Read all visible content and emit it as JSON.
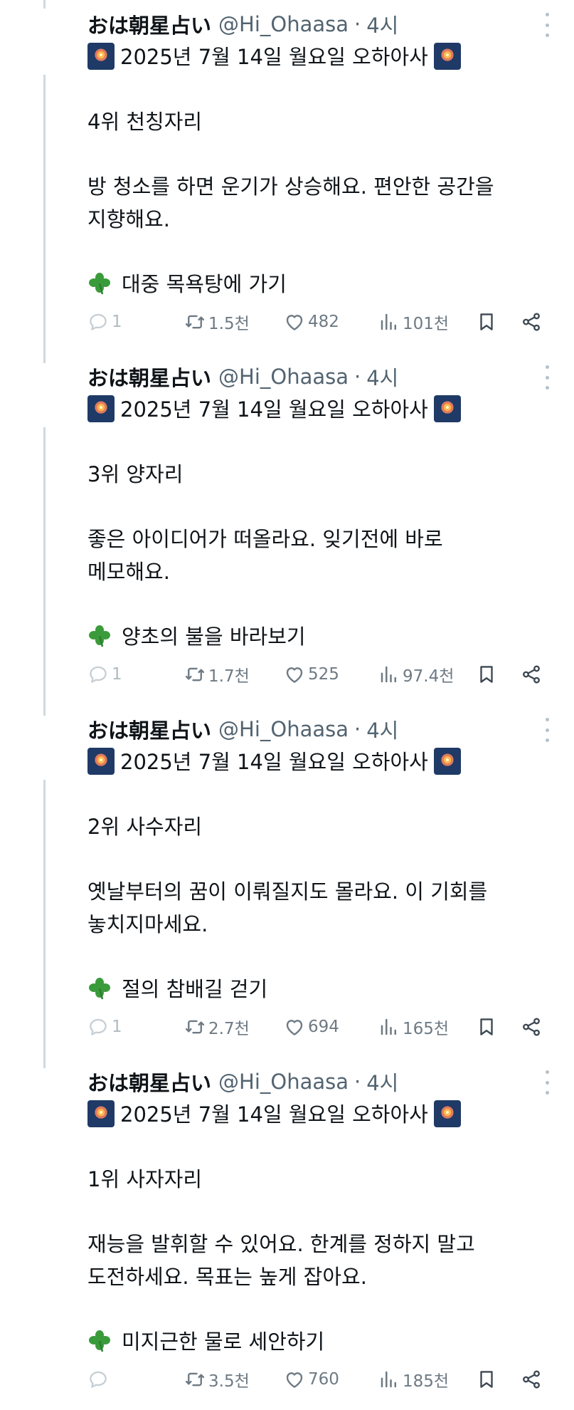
{
  "tweets": [
    {
      "author": "おは朝星占い",
      "handle": "@Hi_Ohaasa",
      "separator": "·",
      "time": "4시",
      "date_line": "2025년 7월 14일 월요일 오하아사",
      "rank": "4위 천칭자리",
      "message_line1": "방 청소를 하면 운기가 상승해요. 편안한 공간을",
      "message_line2": "지향해요.",
      "lucky": "대중 목욕탕에 가기",
      "replies": "1",
      "retweets": "1.5천",
      "likes": "482",
      "views": "101천"
    },
    {
      "author": "おは朝星占い",
      "handle": "@Hi_Ohaasa",
      "separator": "·",
      "time": "4시",
      "date_line": "2025년 7월 14일 월요일 오하아사",
      "rank": "3위 양자리",
      "message_line1": "좋은 아이디어가 떠올라요. 잊기전에 바로",
      "message_line2": "메모해요.",
      "lucky": "양초의 불을 바라보기",
      "replies": "1",
      "retweets": "1.7천",
      "likes": "525",
      "views": "97.4천"
    },
    {
      "author": "おは朝星占い",
      "handle": "@Hi_Ohaasa",
      "separator": "·",
      "time": "4시",
      "date_line": "2025년 7월 14일 월요일 오하아사",
      "rank": "2위 사수자리",
      "message_line1": "옛날부터의 꿈이 이뤄질지도 몰라요. 이 기회를",
      "message_line2": "놓치지마세요.",
      "lucky": "절의 참배길 걷기",
      "replies": "1",
      "retweets": "2.7천",
      "likes": "694",
      "views": "165천"
    },
    {
      "author": "おは朝星占い",
      "handle": "@Hi_Ohaasa",
      "separator": "·",
      "time": "4시",
      "date_line": "2025년 7월 14일 월요일 오하아사",
      "rank": "1위 사자자리",
      "message_line1": "재능을 발휘할 수 있어요. 한계를 정하지 말고",
      "message_line2": "도전하세요. 목표는 높게 잡아요.",
      "lucky": "미지근한 물로 세안하기",
      "replies": "",
      "retweets": "3.5천",
      "likes": "760",
      "views": "185천"
    }
  ],
  "icons": {
    "date_emoji": "fireworks-icon",
    "lucky_emoji": "four-leaf-clover-icon",
    "reply": "reply-icon",
    "retweet": "retweet-icon",
    "like": "heart-icon",
    "views": "views-icon",
    "bookmark": "bookmark-icon",
    "share": "share-icon",
    "more": "more-options-icon"
  },
  "colors": {
    "text_primary": "#0f1419",
    "text_secondary": "#536471",
    "action_gray": "#6e7a84",
    "thread_line": "#cfd9de",
    "clover_green": "#3a9b3a"
  }
}
